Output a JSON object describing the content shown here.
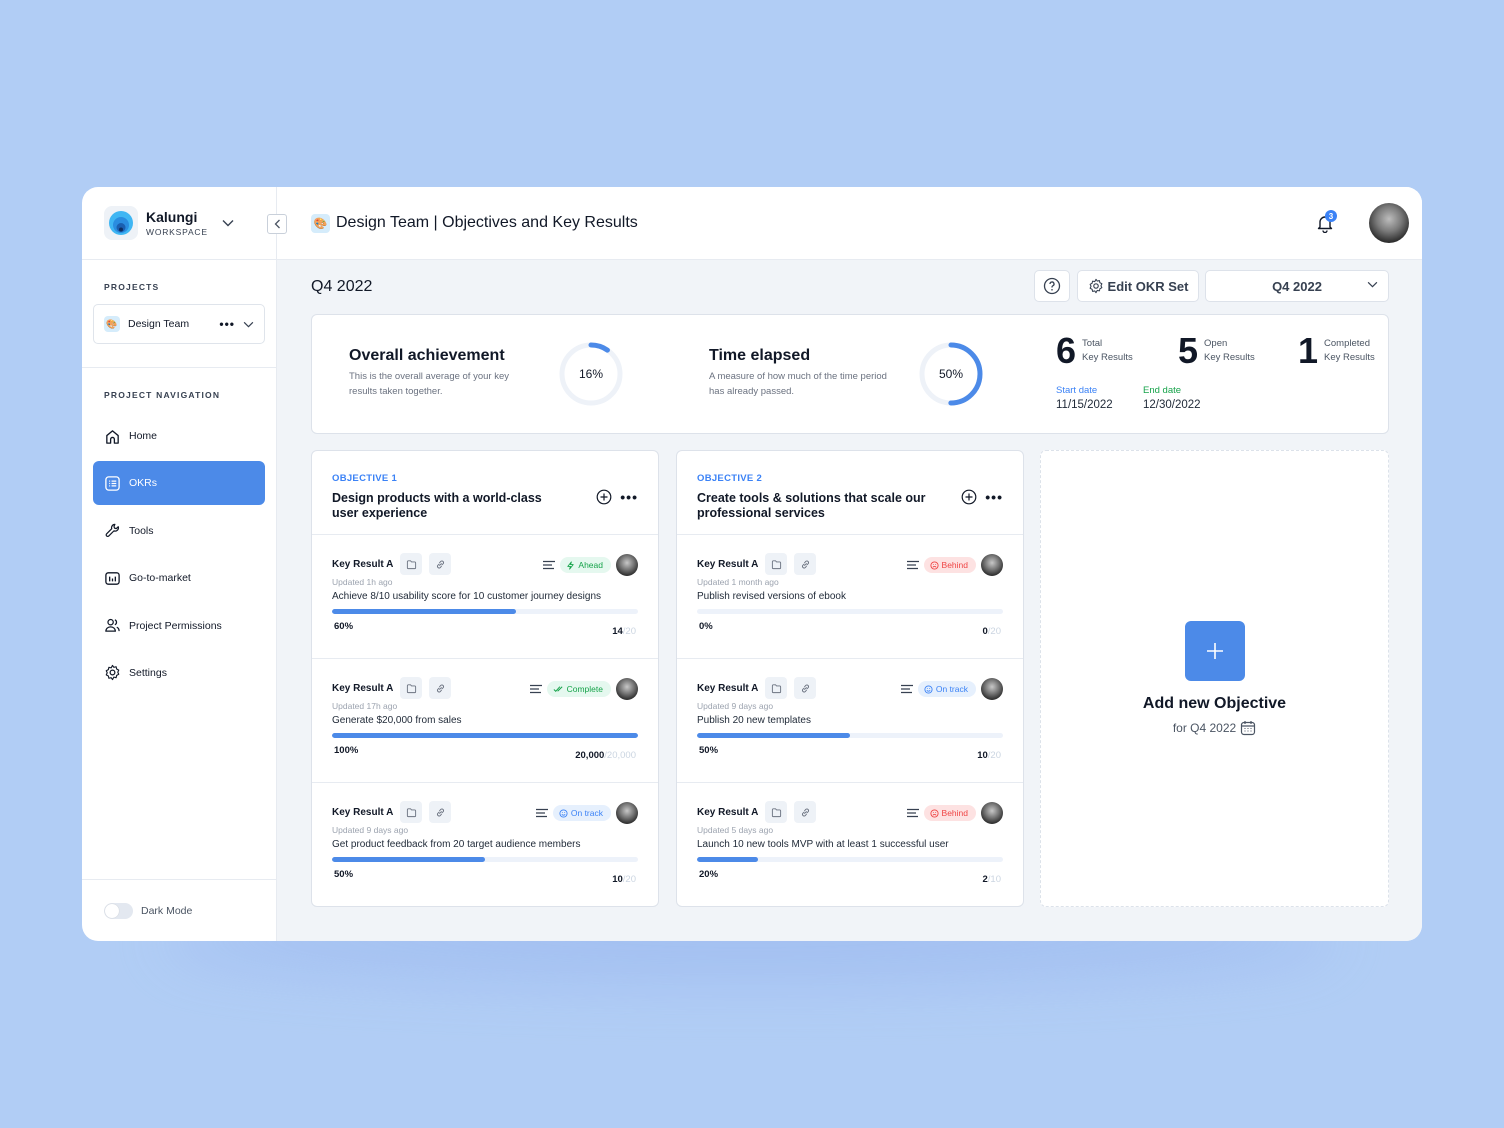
{
  "workspace": {
    "name": "Kalungi",
    "subtitle": "WORKSPACE"
  },
  "projects": {
    "section_label": "PROJECTS",
    "selected": "Design Team"
  },
  "navigation": {
    "section_label": "PROJECT NAVIGATION",
    "items": [
      {
        "label": "Home",
        "icon": "home-icon",
        "active": false
      },
      {
        "label": "OKRs",
        "icon": "list-icon",
        "active": true
      },
      {
        "label": "Tools",
        "icon": "wrench-icon",
        "active": false
      },
      {
        "label": "Go-to-market",
        "icon": "chart-icon",
        "active": false
      },
      {
        "label": "Project Permissions",
        "icon": "users-icon",
        "active": false
      },
      {
        "label": "Settings",
        "icon": "gear-icon",
        "active": false
      }
    ]
  },
  "dark_mode": {
    "label": "Dark Mode",
    "enabled": false
  },
  "header": {
    "title": "Design Team | Objectives and Key Results",
    "notifications_count": "3"
  },
  "toolbar": {
    "period": "Q4 2022",
    "edit_label": "Edit OKR Set",
    "period_select": "Q4 2022"
  },
  "summary": {
    "achievement": {
      "title": "Overall achievement",
      "desc": "This is the overall average of your key results taken together.",
      "value_label": "16%",
      "fraction": 0.16
    },
    "time": {
      "title": "Time elapsed",
      "desc": "A measure of how much of the time period has already passed.",
      "value_label": "50%",
      "fraction": 0.5
    },
    "stats": [
      {
        "num": "6",
        "line1": "Total",
        "line2": "Key Results"
      },
      {
        "num": "5",
        "line1": "Open",
        "line2": "Key Results"
      },
      {
        "num": "1",
        "line1": "Completed",
        "line2": "Key Results"
      }
    ],
    "start_label": "Start date",
    "start_value": "11/15/2022",
    "end_label": "End date",
    "end_value": "12/30/2022",
    "colors": {
      "start": "#3b82f6",
      "end": "#16a34a",
      "accent": "#4c8ae8"
    }
  },
  "objectives": [
    {
      "tag": "OBJECTIVE 1",
      "title": "Design products with a world-class user experience",
      "key_results": [
        {
          "name": "Key Result A",
          "updated": "Updated 1h ago",
          "desc": "Achieve 8/10 usability score for 10 customer journey designs",
          "status": "Ahead",
          "status_class": "ahead",
          "percent_label": "60%",
          "progress": 0.6,
          "current": "14",
          "target": "/20"
        },
        {
          "name": "Key Result A",
          "updated": "Updated 17h ago",
          "desc": "Generate $20,000 from sales",
          "status": "Complete",
          "status_class": "complete",
          "percent_label": "100%",
          "progress": 1.0,
          "current": "20,000",
          "target": "/20,000"
        },
        {
          "name": "Key Result A",
          "updated": "Updated 9 days ago",
          "desc": "Get product feedback from 20 target audience members",
          "status": "On track",
          "status_class": "ontrack",
          "percent_label": "50%",
          "progress": 0.5,
          "current": "10",
          "target": "/20"
        }
      ]
    },
    {
      "tag": "OBJECTIVE 2",
      "title": "Create tools & solutions that scale our professional services",
      "key_results": [
        {
          "name": "Key Result A",
          "updated": "Updated 1 month ago",
          "desc": "Publish revised versions of ebook",
          "status": "Behind",
          "status_class": "behind",
          "percent_label": "0%",
          "progress": 0.0,
          "current": "0",
          "target": "/20"
        },
        {
          "name": "Key Result A",
          "updated": "Updated 9 days ago",
          "desc": "Publish 20 new templates",
          "status": "On track",
          "status_class": "ontrack",
          "percent_label": "50%",
          "progress": 0.5,
          "current": "10",
          "target": "/20"
        },
        {
          "name": "Key Result A",
          "updated": "Updated 5 days ago",
          "desc": "Launch 10 new tools MVP with at least 1 successful user",
          "status": "Behind",
          "status_class": "behind",
          "percent_label": "20%",
          "progress": 0.2,
          "current": "2",
          "target": "/10"
        }
      ]
    }
  ],
  "add_objective": {
    "title": "Add new Objective",
    "subtitle": "for Q4 2022"
  }
}
